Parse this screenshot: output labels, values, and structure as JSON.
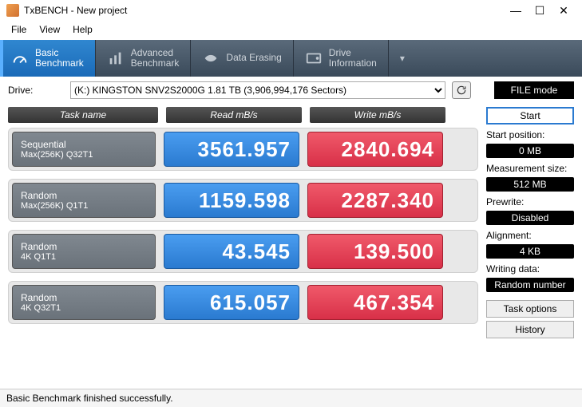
{
  "window": {
    "title": "TxBENCH - New project"
  },
  "menu": {
    "file": "File",
    "view": "View",
    "help": "Help"
  },
  "tabs": {
    "basic": "Basic\nBenchmark",
    "advanced": "Advanced\nBenchmark",
    "erasing": "Data Erasing",
    "driveinfo": "Drive\nInformation"
  },
  "toolbar": {
    "drive_label": "Drive:",
    "drive_value": "(K:) KINGSTON SNV2S2000G  1.81 TB (3,906,994,176 Sectors)",
    "filemode": "FILE mode"
  },
  "headers": {
    "task": "Task name",
    "read": "Read mB/s",
    "write": "Write mB/s"
  },
  "rows": [
    {
      "name1": "Sequential",
      "name2": "Max(256K) Q32T1",
      "read": "3561.957",
      "write": "2840.694"
    },
    {
      "name1": "Random",
      "name2": "Max(256K) Q1T1",
      "read": "1159.598",
      "write": "2287.340"
    },
    {
      "name1": "Random",
      "name2": "4K Q1T1",
      "read": "43.545",
      "write": "139.500"
    },
    {
      "name1": "Random",
      "name2": "4K Q32T1",
      "read": "615.057",
      "write": "467.354"
    }
  ],
  "side": {
    "start": "Start",
    "startpos_label": "Start position:",
    "startpos_val": "0 MB",
    "meas_label": "Measurement size:",
    "meas_val": "512 MB",
    "prewrite_label": "Prewrite:",
    "prewrite_val": "Disabled",
    "align_label": "Alignment:",
    "align_val": "4 KB",
    "writing_label": "Writing data:",
    "writing_val": "Random number",
    "taskopt": "Task options",
    "history": "History"
  },
  "status": "Basic Benchmark finished successfully."
}
